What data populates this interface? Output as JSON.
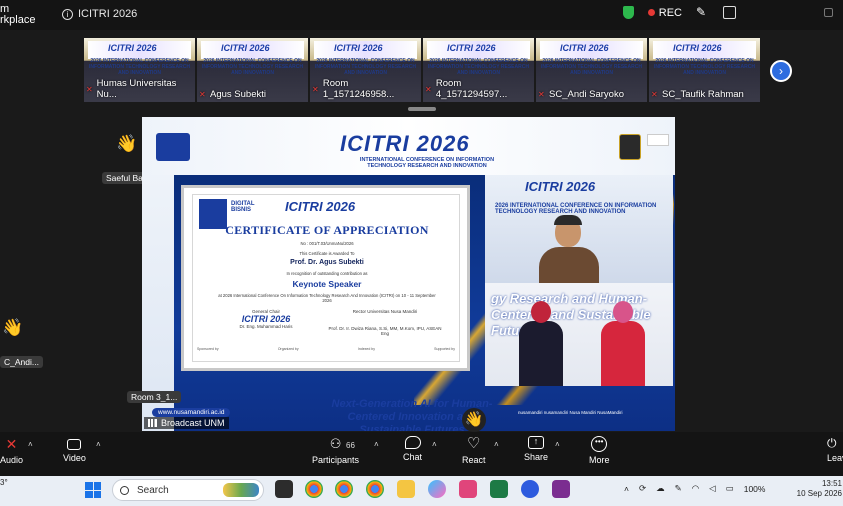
{
  "app": {
    "brand_line1": "m",
    "brand_line2": "rkplace",
    "meeting_title": "ICITRI 2026",
    "rec_label": "REC"
  },
  "filmstrip": [
    {
      "name": "Humas Universitas Nu..."
    },
    {
      "name": "Agus Subekti"
    },
    {
      "name": "Room 1_1571246958..."
    },
    {
      "name": "Room 4_1571294597..."
    },
    {
      "name": "SC_Andi Saryoko"
    },
    {
      "name": "SC_Taufik Rahman"
    }
  ],
  "filmstrip_banner": "2026 INTERNATIONAL CONFERENCE ON INFORMATION TECHNOLOGY RESEARCH AND INNOVATION",
  "filmstrip_logo": "ICITRI 2026",
  "side_participants": {
    "p1": "Saeful Ba...",
    "p2": "C_Andi...",
    "p3": "Room 3_1..."
  },
  "broadcast_label": "Broadcast UNM",
  "shared_screen": {
    "header_logo": "ICITRI 2026",
    "header_sub": "INTERNATIONAL CONFERENCE ON INFORMATION TECHNOLOGY RESEARCH AND INNOVATION",
    "certificate": {
      "digital": "DIGITAL BISNIS",
      "logo": "ICITRI 2026",
      "title": "CERTIFICATE OF APPRECIATION",
      "number": "No : 001/T.03/UnmaNu/2026",
      "awarded": "This Certificate is Awarded To",
      "name": "Prof. Dr. Agus Subekti",
      "recognition": "In recognition of outstanding contribution as",
      "role": "Keynote Speaker",
      "event": "at 2026 International Conference On Information Technology Research And Innovation (ICITRI) on 10 - 11 September 2026",
      "sig1_role": "General Chair",
      "sig1_name": "Dr. Eng. Muhammad Haris",
      "sig2_role": "Rector Universitas Nusa Mandiri",
      "sig2_name": "Prof. Dr. Ir. Dwiza Riana, S.Si, MM, M.Kom, IPU, ASEAN Eng",
      "sponsored": "Sponsored by",
      "organized": "Organized by",
      "indexed": "Indexed by",
      "supported": "Supported by"
    },
    "video_banner": "2026 INTERNATIONAL CONFERENCE ON INFORMATION TECHNOLOGY RESEARCH AND INNOVATION",
    "video_bottom_text": "gy Research and Human-Centered and Sustainable Futures",
    "next_gen": "Next-Generation AI for Human-Centered Innovation and Sustainable Futures",
    "url_left": "www.nusamandiri.ac.id",
    "url_right": "nusamandiri   nusamandiri   Nusa Mandiri   NusaMandiri"
  },
  "toolbar": {
    "audio": "Audio",
    "video": "Video",
    "participants": "Participants",
    "participants_count": "66",
    "chat": "Chat",
    "react": "React",
    "share": "Share",
    "more": "More",
    "leave": "Leav"
  },
  "taskbar": {
    "weather": "3°",
    "search_placeholder": "Search",
    "battery": "100%",
    "time": "13:51",
    "date": "10 Sep 2026"
  },
  "colors": {
    "accent": "#1a3d9f",
    "rec": "#e53935",
    "shield": "#2db84d"
  }
}
